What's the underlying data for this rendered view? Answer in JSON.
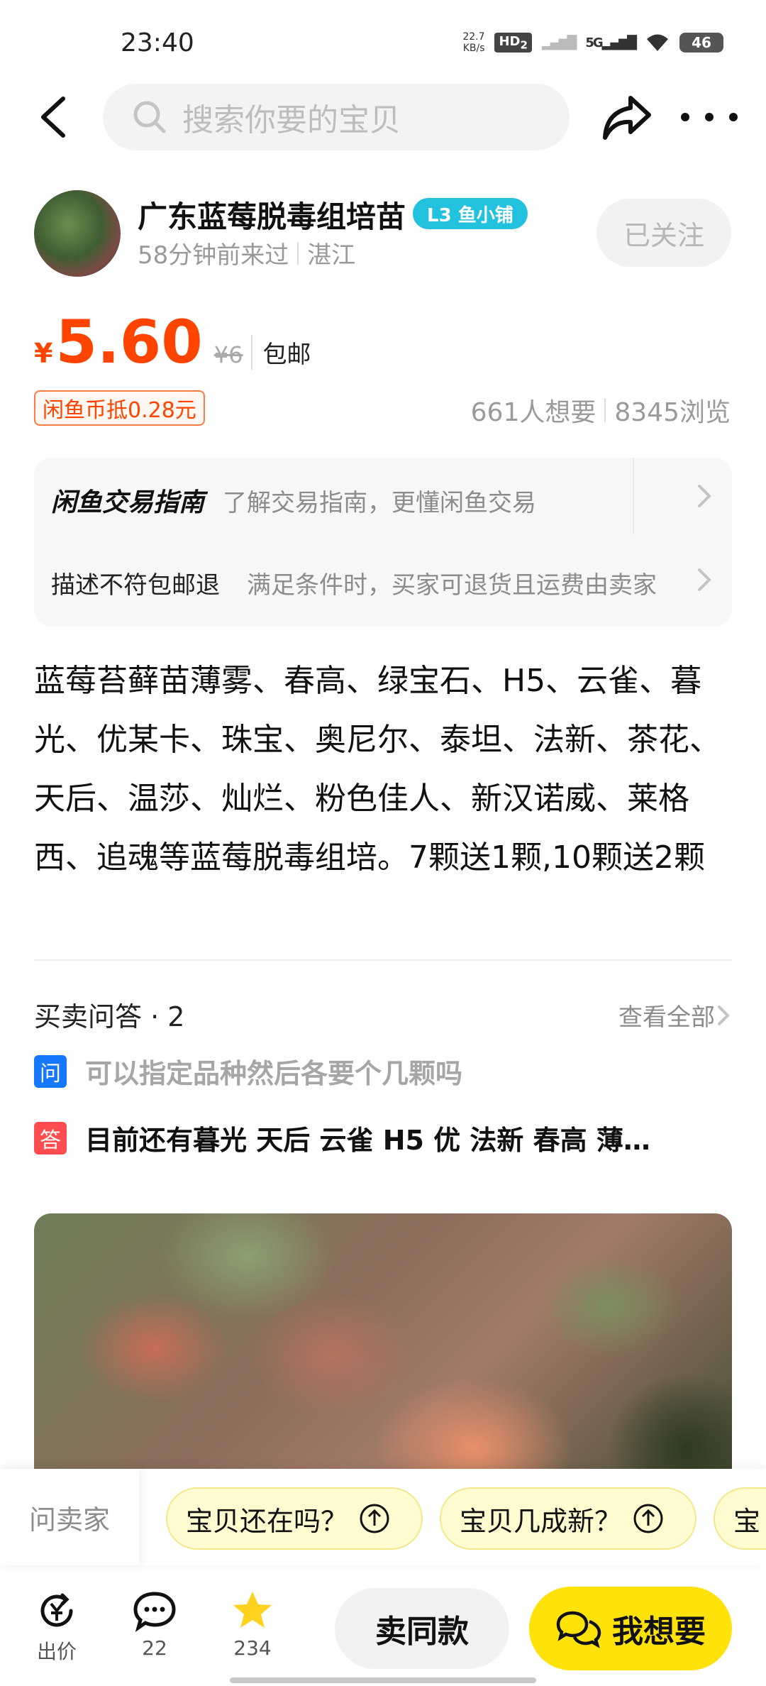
{
  "status_bar": {
    "time": "23:40",
    "speed_value": "22.7",
    "speed_unit": "KB/s",
    "hd": "HD",
    "hd_sub": "2",
    "network": "5G",
    "battery": "46"
  },
  "header": {
    "search_placeholder": "搜索你要的宝贝"
  },
  "seller": {
    "name": "广东蓝莓脱毒组培苗",
    "badge": "L3 鱼小铺",
    "last_seen": "58分钟前来过",
    "location": "湛江",
    "follow_label": "已关注"
  },
  "price": {
    "currency": "¥",
    "value": "5.60",
    "original": "¥6",
    "shipping": "包邮",
    "coin_offer": "闲鱼币抵0.28元",
    "wants": "661人想要",
    "views": "8345浏览"
  },
  "guide": {
    "title": "闲鱼交易指南",
    "subtitle": "了解交易指南，更懂闲鱼交易",
    "policy_label": "描述不符包邮退",
    "policy_desc": "满足条件时，买家可退货且运费由卖家"
  },
  "description": "蓝莓苔藓苗薄雾、春高、绿宝石、H5、云雀、暮光、优某卡、珠宝、奥尼尔、泰坦、法新、茶花、天后、温莎、灿烂、粉色佳人、新汉诺威、莱格西、追魂等蓝莓脱毒组培。7颗送1颗,10颗送2颗",
  "qa": {
    "title": "买卖问答 · 2",
    "view_all": "查看全部",
    "q_badge": "问",
    "a_badge": "答",
    "question": "可以指定品种然后各要个几颗吗",
    "answer": "目前还有暮光 天后 云雀 H5 优 法新 春高 薄…"
  },
  "quick_bar": {
    "ask_label": "问卖家",
    "chips": [
      "宝贝还在吗？",
      "宝贝几成新？",
      "宝"
    ]
  },
  "toolbar": {
    "bid_label": "出价",
    "chat_count": "22",
    "fav_count": "234",
    "same_label": "卖同款",
    "want_label": "我想要"
  },
  "colors": {
    "accent": "#ff4400",
    "want_button": "#ffe20a",
    "badge": "#22c1dd",
    "q_badge": "#1677ff",
    "a_badge": "#ff4d4f"
  }
}
